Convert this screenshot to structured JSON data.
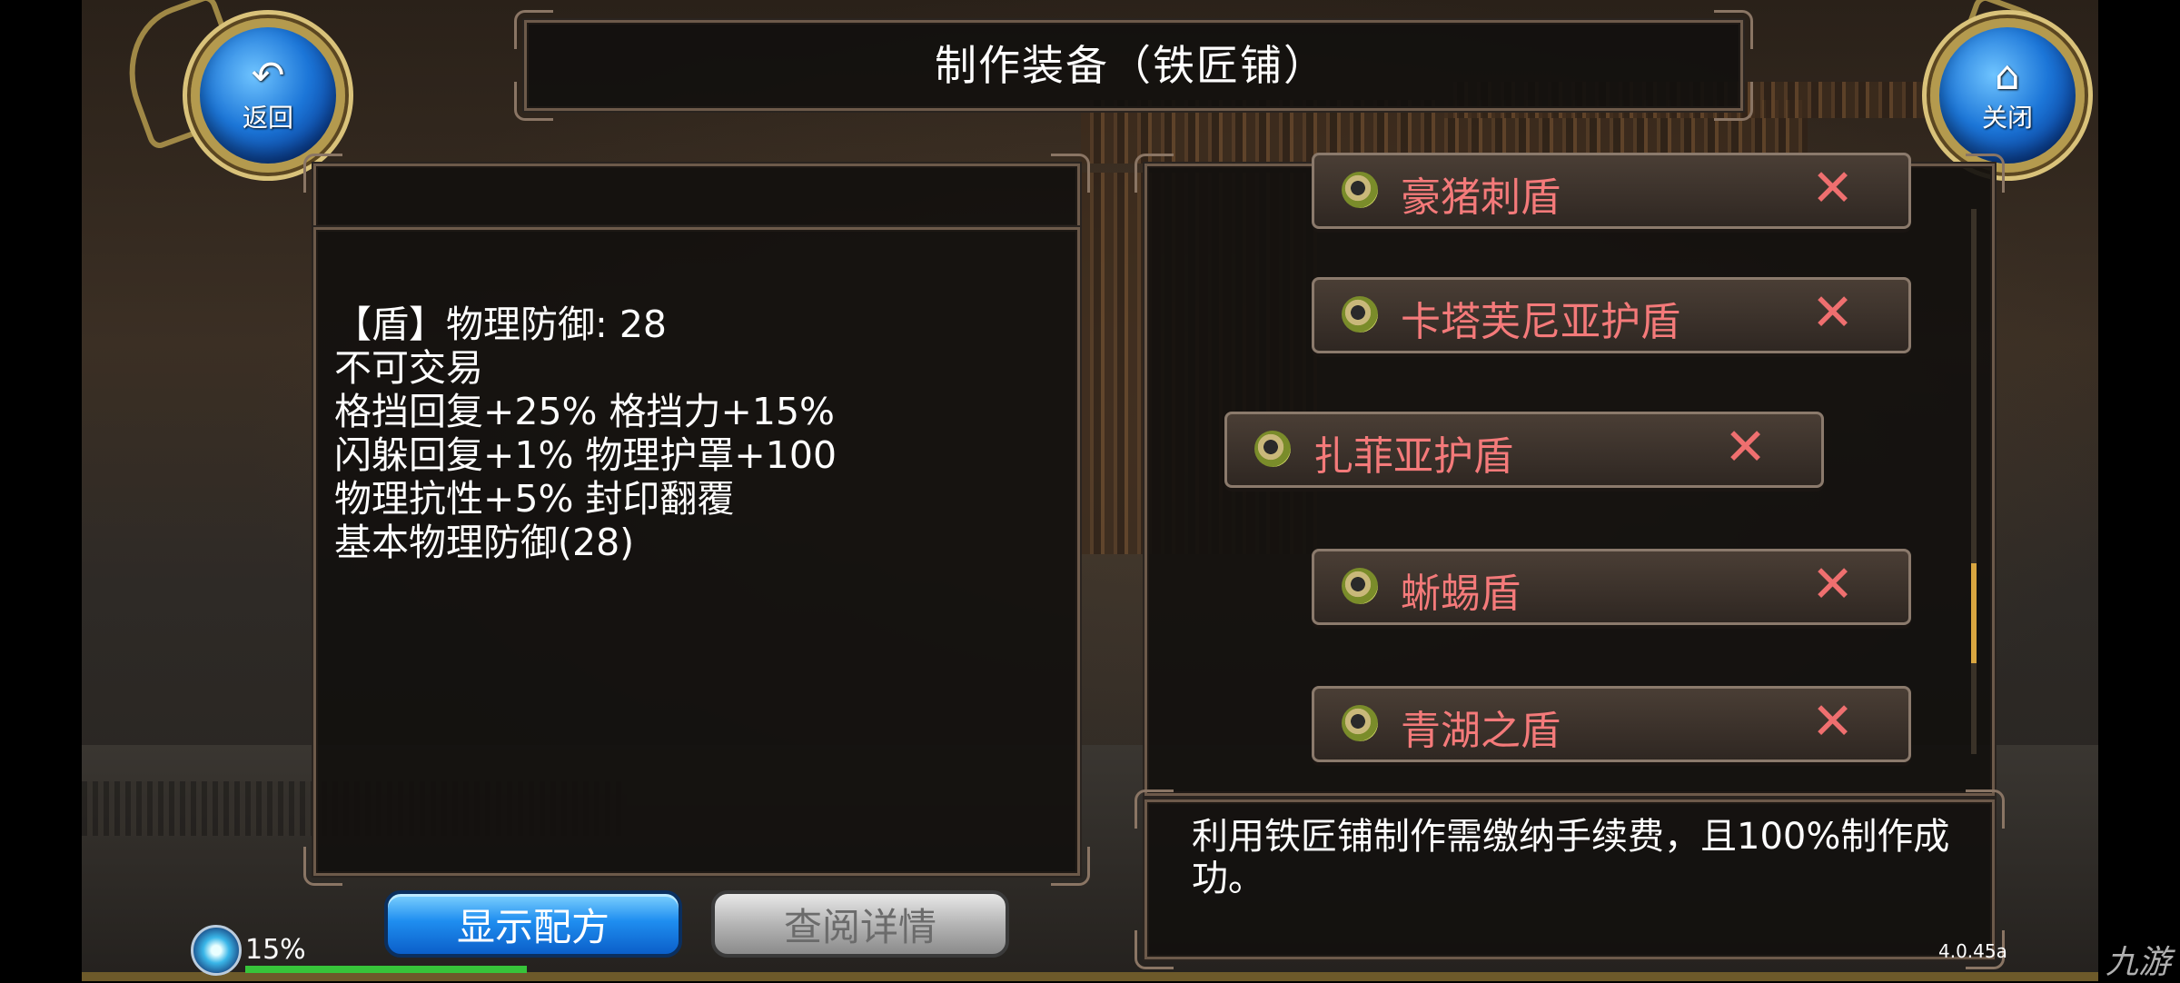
{
  "title": "制作装备（铁匠铺）",
  "nav": {
    "back_label": "返回",
    "close_label": "关闭"
  },
  "item_detail": {
    "lines": [
      "【盾】物理防御: 28",
      "不可交易",
      "格挡回复+25% 格挡力+15%",
      "闪躲回复+1% 物理护罩+100",
      "物理抗性+5% 封印翻覆",
      "基本物理防御(28)"
    ]
  },
  "recipe_list": {
    "items": [
      {
        "name": "豪猪刺盾",
        "selected": false
      },
      {
        "name": "卡塔芙尼亚护盾",
        "selected": false
      },
      {
        "name": "扎菲亚护盾",
        "selected": true
      },
      {
        "name": "蜥蜴盾",
        "selected": false
      },
      {
        "name": "青湖之盾",
        "selected": false
      }
    ],
    "remove_symbol": "✕"
  },
  "info_text": "利用铁匠铺制作需缴纳手续费，且100%制作成功。",
  "buttons": {
    "show_recipe": "显示配方",
    "view_details": "查阅详情"
  },
  "status": {
    "percent": "15%",
    "version": "4.0.45a"
  },
  "watermark": "九游",
  "colors": {
    "item_name": "#f47a7a",
    "remove_x": "#ef6f6f",
    "blue_button": "#1f8ef0",
    "scroll_thumb": "#d9a640"
  }
}
